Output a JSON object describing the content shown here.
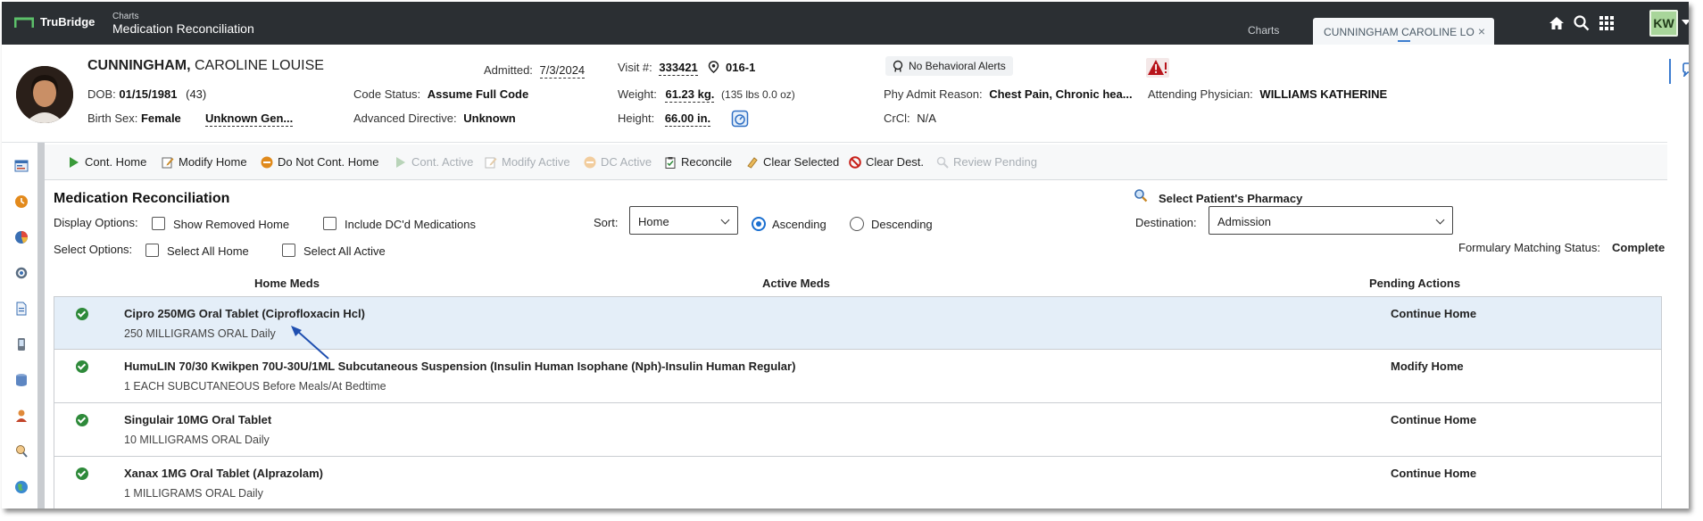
{
  "app": {
    "brand": "TruBridge",
    "breadcrumb_small": "Charts",
    "breadcrumb_title": "Medication Reconciliation",
    "tabs": [
      {
        "label": "Charts"
      },
      {
        "label": "CUNNINGHAM CAROLINE LO",
        "close": "×"
      }
    ],
    "user_initials": "KW"
  },
  "patient": {
    "last_name": "CUNNINGHAM,",
    "first_name": " CAROLINE LOUISE",
    "dob_label": "DOB:",
    "dob": "01/15/1981",
    "age": "(43)",
    "birth_sex_label": "Birth Sex:",
    "birth_sex": "Female",
    "gender": "Unknown Gen...",
    "admitted_label": "Admitted:",
    "admitted": "7/3/2024",
    "code_status_label": "Code Status:",
    "code_status": "Assume Full Code",
    "adv_directive_label": "Advanced Directive:",
    "adv_directive": "Unknown",
    "visit_label": "Visit #:",
    "visit": "333421",
    "room": "016-1",
    "weight_label": "Weight:",
    "weight": "61.23 kg.",
    "weight_lbs": "(135 lbs 0.0 oz)",
    "height_label": "Height:",
    "height": "66.00 in.",
    "alerts": "No Behavioral Alerts",
    "admit_reason_label": "Phy Admit Reason:",
    "admit_reason": "Chest Pain, Chronic hea...",
    "crcl_label": "CrCl:",
    "crcl": "N/A",
    "attending_label": "Attending Physician:",
    "attending": "WILLIAMS KATHERINE"
  },
  "toolbar": {
    "items": [
      {
        "label": "Cont. Home",
        "enabled": true
      },
      {
        "label": "Modify Home",
        "enabled": true
      },
      {
        "label": "Do Not Cont. Home",
        "enabled": true
      },
      {
        "label": "Cont. Active",
        "enabled": false
      },
      {
        "label": "Modify Active",
        "enabled": false
      },
      {
        "label": "DC Active",
        "enabled": false
      },
      {
        "label": "Reconcile",
        "enabled": true
      },
      {
        "label": "Clear Selected",
        "enabled": true
      },
      {
        "label": "Clear Dest.",
        "enabled": true
      },
      {
        "label": "Review Pending",
        "enabled": false
      }
    ]
  },
  "main": {
    "title": "Medication Reconciliation",
    "display_options_label": "Display Options:",
    "show_removed_home": "Show Removed Home",
    "include_dc": "Include DC'd Medications",
    "select_options_label": "Select Options:",
    "select_all_home": "Select All Home",
    "select_all_active": "Select All Active",
    "sort_label": "Sort:",
    "sort_value": "Home",
    "ascending": "Ascending",
    "descending": "Descending",
    "pharmacy": "Select Patient's Pharmacy",
    "destination_label": "Destination:",
    "destination_value": "Admission",
    "formulary_label": "Formulary Matching Status:",
    "formulary_value": "Complete",
    "col_home": "Home Meds",
    "col_active": "Active Meds",
    "col_pending": "Pending Actions",
    "meds": [
      {
        "name": "Cipro 250MG Oral Tablet (Ciprofloxacin Hcl)",
        "sig": "250 MILLIGRAMS ORAL Daily",
        "action": "Continue Home"
      },
      {
        "name": "HumuLIN 70/30 Kwikpen 70U-30U/1ML Subcutaneous Suspension (Insulin Human Isophane (Nph)-Insulin Human Regular)",
        "sig": "1 EACH SUBCUTANEOUS Before Meals/At Bedtime",
        "action": "Modify Home"
      },
      {
        "name": "Singulair 10MG Oral Tablet",
        "sig": "10 MILLIGRAMS ORAL Daily",
        "action": "Continue Home"
      },
      {
        "name": "Xanax 1MG Oral Tablet (Alprazolam)",
        "sig": "1 MILLIGRAMS ORAL Daily",
        "action": "Continue Home"
      }
    ]
  },
  "colors": {
    "topbar": "#2b2f33",
    "accent": "#1a6fd0",
    "selected_row": "#e4eef8",
    "check_green": "#2e8a3a"
  }
}
